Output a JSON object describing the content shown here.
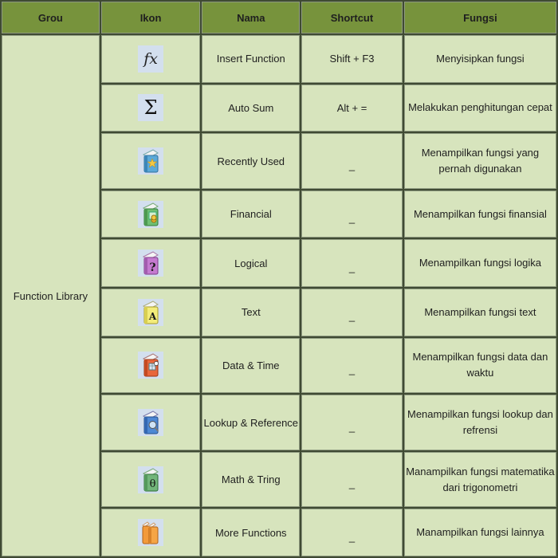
{
  "table": {
    "headers": {
      "group": "Grou",
      "icon": "Ikon",
      "name": "Nama",
      "shortcut": "Shortcut",
      "function": "Fungsi"
    },
    "group_label": "Function Library",
    "rows": [
      {
        "icon": "insert-function-fx-icon",
        "name": "Insert Function",
        "shortcut": "Shift + F3",
        "function": "Menyisipkan fungsi"
      },
      {
        "icon": "autosum-sigma-icon",
        "name": "Auto Sum",
        "shortcut": "Alt + =",
        "function": "Melakukan penghitungan cepat"
      },
      {
        "icon": "recently-used-book-star-icon",
        "name": "Recently Used",
        "shortcut": "_",
        "function": "Menampilkan fungsi yang pernah digunakan"
      },
      {
        "icon": "financial-book-coins-icon",
        "name": "Financial",
        "shortcut": "_",
        "function": "Menampilkan fungsi finansial"
      },
      {
        "icon": "logical-book-question-icon",
        "name": "Logical",
        "shortcut": "_",
        "function": "Menampilkan fungsi logika"
      },
      {
        "icon": "text-book-a-icon",
        "name": "Text",
        "shortcut": "_",
        "function": "Menampilkan fungsi text"
      },
      {
        "icon": "date-time-book-calendar-icon",
        "name": "Data & Time",
        "shortcut": "_",
        "function": "Menampilkan fungsi data dan waktu"
      },
      {
        "icon": "lookup-reference-book-magnifier-icon",
        "name": "Lookup & Reference",
        "shortcut": "_",
        "function": "Menampilkan fungsi lookup dan refrensi"
      },
      {
        "icon": "math-trig-book-theta-icon",
        "name": "Math & Tring",
        "shortcut": "_",
        "function": "Manampilkan fungsi matematika dari trigonometri"
      },
      {
        "icon": "more-functions-books-icon",
        "name": "More Functions",
        "shortcut": "_",
        "function": "Manampilkan fungsi lainnya"
      }
    ],
    "icon_glyphs": {
      "fx": "fx",
      "sigma": "Σ",
      "question": "?",
      "letter_a": "A",
      "theta": "θ"
    },
    "colors": {
      "header_bg": "#77933c",
      "cell_bg": "#d7e4bd",
      "border": "#3f4a33"
    }
  }
}
